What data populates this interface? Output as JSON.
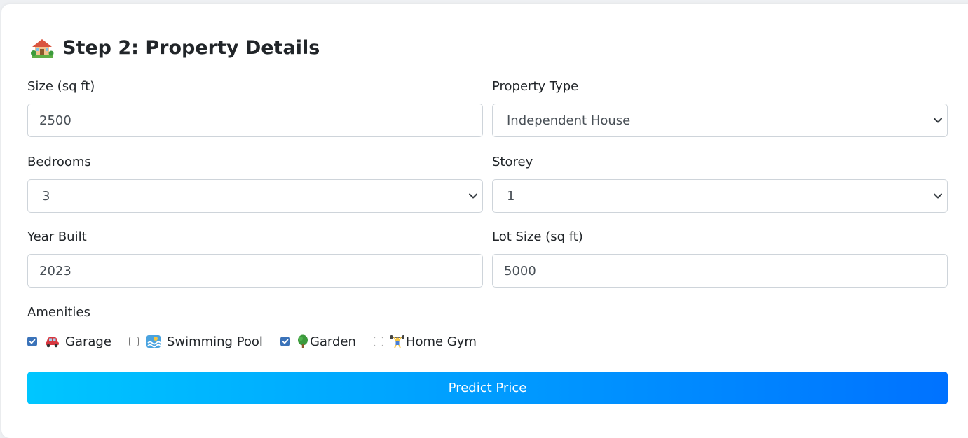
{
  "section": {
    "title": "Step 2: Property Details",
    "title_icon": "house-with-garden-icon"
  },
  "fields": {
    "size": {
      "label": "Size (sq ft)",
      "value": "2500"
    },
    "property_type": {
      "label": "Property Type",
      "value": "Independent House"
    },
    "bedrooms": {
      "label": "Bedrooms",
      "value": "3"
    },
    "storey": {
      "label": "Storey",
      "value": "1"
    },
    "year_built": {
      "label": "Year Built",
      "value": "2023"
    },
    "lot_size": {
      "label": "Lot Size (sq ft)",
      "value": "5000"
    }
  },
  "amenities": {
    "label": "Amenities",
    "items": [
      {
        "label": "Garage",
        "checked": true,
        "icon": "car-icon"
      },
      {
        "label": "Swimming Pool",
        "checked": false,
        "icon": "swimmer-icon"
      },
      {
        "label": "Garden",
        "checked": true,
        "icon": "tree-icon"
      },
      {
        "label": "Home Gym",
        "checked": false,
        "icon": "weightlifter-icon"
      }
    ]
  },
  "actions": {
    "predict_label": "Predict Price"
  },
  "colors": {
    "button_gradient_start": "#00c6ff",
    "button_gradient_end": "#0072ff",
    "checkbox_checked": "#3b73b9"
  }
}
